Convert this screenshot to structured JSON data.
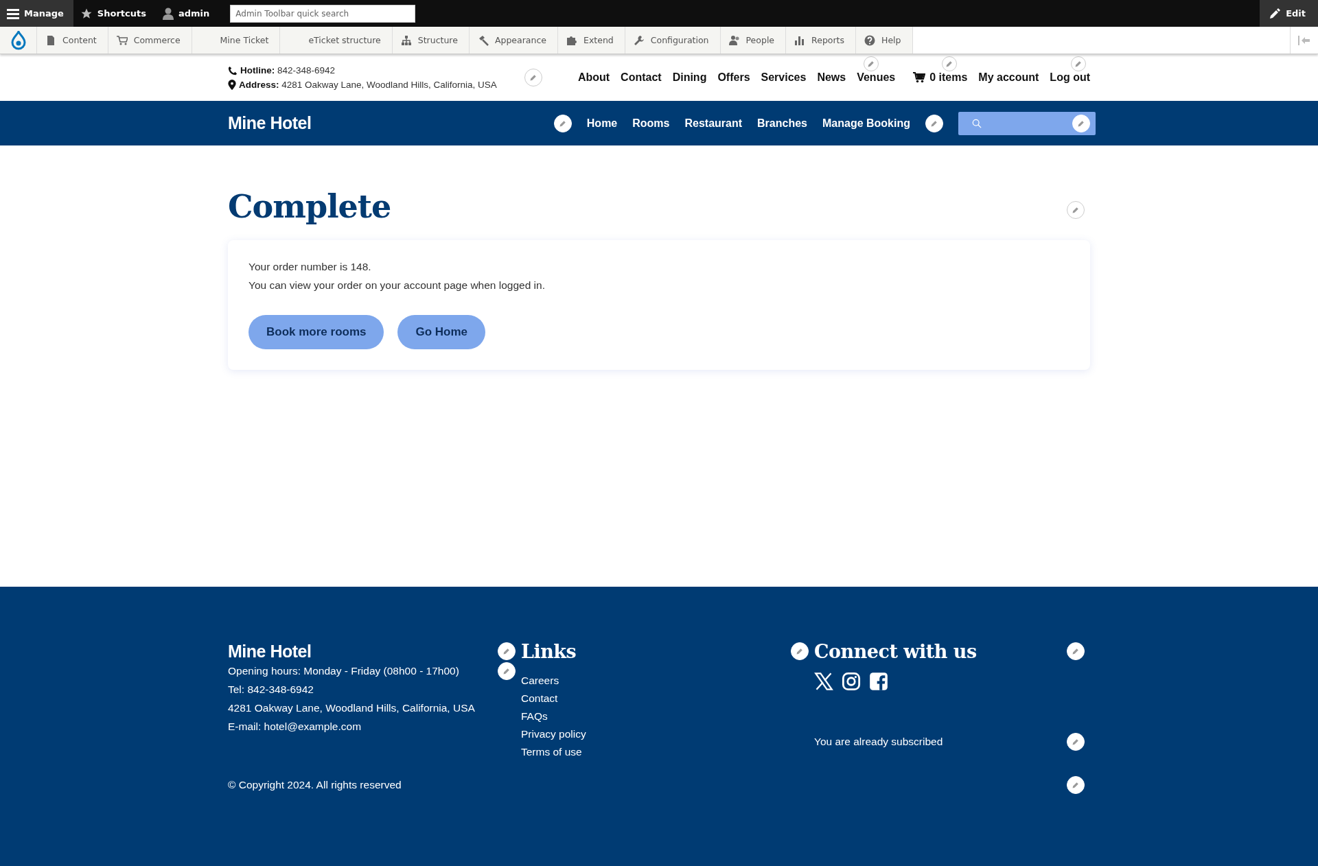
{
  "admin_toolbar": {
    "tabs": [
      {
        "label": "Manage",
        "selected": true
      },
      {
        "label": "Shortcuts",
        "selected": false
      },
      {
        "label": "admin",
        "selected": false
      }
    ],
    "search": {
      "placeholder": "Admin Toolbar quick search"
    },
    "edit_button": "Edit"
  },
  "admin_menu": {
    "items": [
      {
        "label": "Content"
      },
      {
        "label": "Commerce"
      },
      {
        "label": "Mine Ticket"
      },
      {
        "label": "eTicket structure"
      },
      {
        "label": "Structure"
      },
      {
        "label": "Appearance"
      },
      {
        "label": "Extend"
      },
      {
        "label": "Configuration"
      },
      {
        "label": "People"
      },
      {
        "label": "Reports"
      },
      {
        "label": "Help"
      }
    ]
  },
  "top_header": {
    "hotline_label": "Hotline:",
    "hotline": "842-348-6942",
    "address_label": "Address:",
    "address": "4281 Oakway Lane, Woodland Hills, California, USA",
    "links": [
      "About",
      "Contact",
      "Dining",
      "Offers",
      "Services",
      "News",
      "Venues"
    ],
    "cart": "0 items",
    "account_links": [
      "My account",
      "Log out"
    ]
  },
  "navbar": {
    "brand": "Mine Hotel",
    "items": [
      "Home",
      "Rooms",
      "Restaurant",
      "Branches",
      "Manage Booking"
    ]
  },
  "page": {
    "title": "Complete",
    "messages": [
      "Your order number is 148.",
      "You can view your order on your account page when logged in."
    ],
    "buttons": [
      "Book more rooms",
      "Go Home"
    ]
  },
  "footer": {
    "brand": "Mine Hotel",
    "info": [
      "Opening hours: Monday - Friday (08h00 - 17h00)",
      "Tel: 842-348-6942",
      "4281 Oakway Lane, Woodland Hills, California, USA",
      "E-mail: hotel@example.com"
    ],
    "links_title": "Links",
    "links": [
      "Careers",
      "Contact",
      "FAQs",
      "Privacy policy",
      "Terms of use"
    ],
    "connect_title": "Connect with us",
    "subscribed": "You are already subscribed",
    "copyright": "© Copyright 2024. All rights reserved"
  }
}
